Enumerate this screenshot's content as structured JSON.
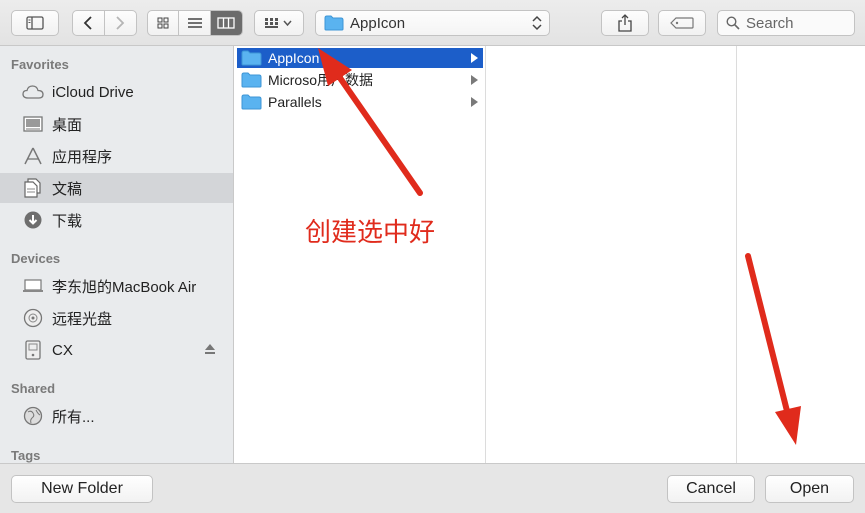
{
  "toolbar": {
    "path_label": "AppIcon",
    "search_placeholder": "Search"
  },
  "sidebar": {
    "favorites_title": "Favorites",
    "devices_title": "Devices",
    "shared_title": "Shared",
    "tags_title": "Tags",
    "favorites": [
      {
        "label": "iCloud Drive",
        "icon": "cloud-icon"
      },
      {
        "label": "桌面",
        "icon": "desktop-icon"
      },
      {
        "label": "应用程序",
        "icon": "applications-icon"
      },
      {
        "label": "文稿",
        "icon": "documents-icon",
        "selected": true
      },
      {
        "label": "下载",
        "icon": "download-icon"
      }
    ],
    "devices": [
      {
        "label": "李东旭的MacBook Air",
        "icon": "laptop-icon"
      },
      {
        "label": "远程光盘",
        "icon": "disc-icon"
      },
      {
        "label": "CX",
        "icon": "drive-icon"
      }
    ],
    "shared": [
      {
        "label": "所有...",
        "icon": "network-icon"
      }
    ]
  },
  "column1": {
    "items": [
      {
        "label": "AppIcon",
        "selected": true
      },
      {
        "label": "Microso用户数据"
      },
      {
        "label": "Parallels"
      }
    ]
  },
  "annotation": {
    "text": "创建选中好",
    "color": "#e02b1c"
  },
  "bottom": {
    "new_folder_label": "New Folder",
    "cancel_label": "Cancel",
    "open_label": "Open"
  },
  "colors": {
    "selection": "#1c5ec9",
    "folder": "#5ab3f0"
  }
}
